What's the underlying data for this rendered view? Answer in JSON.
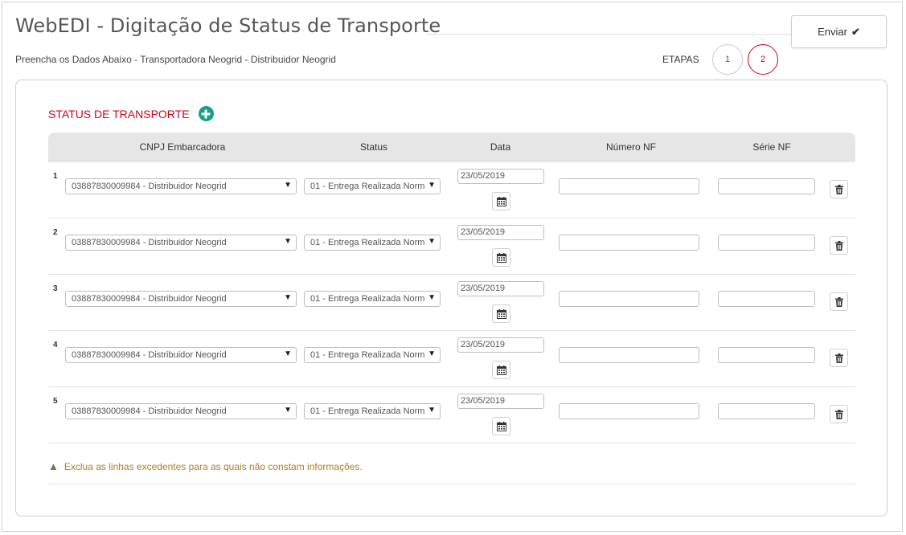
{
  "header": {
    "title": "WebEDI - Digitação de Status de Transporte",
    "subtitle": "Preencha os Dados Abaixo - Transportadora Neogrid - Distribuidor Neogrid",
    "send_label": "Enviar",
    "steps_label": "ETAPAS",
    "steps": [
      "1",
      "2"
    ],
    "active_step": "2"
  },
  "section": {
    "title": "STATUS DE TRANSPORTE"
  },
  "table": {
    "columns": [
      "CNPJ Embarcadora",
      "Status",
      "Data",
      "Número NF",
      "Série NF"
    ],
    "rows": [
      {
        "num": "1",
        "cnpj": "03887830009984 - Distribuidor Neogrid",
        "status": "01 - Entrega Realizada Norm",
        "date": "23/05/2019",
        "nf": "",
        "serie": ""
      },
      {
        "num": "2",
        "cnpj": "03887830009984 - Distribuidor Neogrid",
        "status": "01 - Entrega Realizada Norm",
        "date": "23/05/2019",
        "nf": "",
        "serie": ""
      },
      {
        "num": "3",
        "cnpj": "03887830009984 - Distribuidor Neogrid",
        "status": "01 - Entrega Realizada Norm",
        "date": "23/05/2019",
        "nf": "",
        "serie": ""
      },
      {
        "num": "4",
        "cnpj": "03887830009984 - Distribuidor Neogrid",
        "status": "01 - Entrega Realizada Norm",
        "date": "23/05/2019",
        "nf": "",
        "serie": ""
      },
      {
        "num": "5",
        "cnpj": "03887830009984 - Distribuidor Neogrid",
        "status": "01 - Entrega Realizada Norm",
        "date": "23/05/2019",
        "nf": "",
        "serie": ""
      }
    ]
  },
  "warning": {
    "text": "Exclua as linhas excedentes para as quais não constam informações."
  },
  "icons": {
    "send": "check-icon",
    "add": "plus-circle-icon",
    "calendar": "calendar-icon",
    "delete": "trash-icon",
    "warning": "warning-icon",
    "dropdown": "caret-down-icon"
  },
  "colors": {
    "accent": "#d0021b",
    "add_button": "#1a9e84",
    "warning_text": "#b07b2a"
  }
}
